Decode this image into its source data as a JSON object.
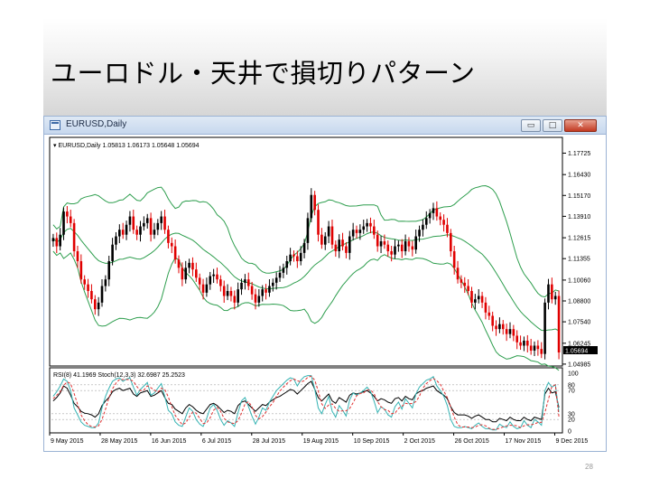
{
  "slide": {
    "title": "ユーロドル・天井で損切りパターン",
    "page_number": "28"
  },
  "window": {
    "title": "EURUSD,Daily",
    "minimize_label": "▭",
    "maximize_label": "□",
    "close_label": "✕"
  },
  "chart_data": [
    {
      "type": "candlestick",
      "title": "EURUSD,Daily  1.05813 1.06173 1.05648 1.05694",
      "symbol": "EURUSD,Daily",
      "last_ohlc": {
        "open": 1.05813,
        "high": 1.06173,
        "low": 1.05648,
        "close": 1.05694
      },
      "current_price_label": "1.05694",
      "y_ticks": [
        1.17725,
        1.1643,
        1.1517,
        1.1391,
        1.12615,
        1.11355,
        1.1006,
        1.088,
        1.0754,
        1.06245,
        1.04985
      ],
      "ylim": [
        1.0498,
        1.1775
      ],
      "x_tick_labels": [
        "9 May 2015",
        "28 May 2015",
        "16 Jun 2015",
        "6 Jul 2015",
        "28 Jul 2015",
        "19 Aug 2015",
        "10 Sep 2015",
        "2 Oct 2015",
        "26 Oct 2015",
        "17 Nov 2015",
        "9 Dec 2015"
      ],
      "indicators": "Bollinger Bands (approx.)",
      "colors": {
        "up": "#000000",
        "down": "#e00000",
        "bands": "#2e9e4e"
      },
      "closes": [
        1.126,
        1.121,
        1.128,
        1.142,
        1.139,
        1.135,
        1.118,
        1.112,
        1.101,
        1.098,
        1.094,
        1.089,
        1.083,
        1.087,
        1.097,
        1.101,
        1.112,
        1.122,
        1.127,
        1.131,
        1.128,
        1.134,
        1.139,
        1.131,
        1.128,
        1.133,
        1.135,
        1.138,
        1.128,
        1.131,
        1.135,
        1.139,
        1.131,
        1.123,
        1.121,
        1.113,
        1.108,
        1.101,
        1.108,
        1.111,
        1.107,
        1.102,
        1.098,
        1.093,
        1.098,
        1.103,
        1.104,
        1.101,
        1.097,
        1.091,
        1.094,
        1.091,
        1.087,
        1.095,
        1.099,
        1.101,
        1.097,
        1.092,
        1.087,
        1.091,
        1.095,
        1.093,
        1.097,
        1.099,
        1.102,
        1.105,
        1.108,
        1.112,
        1.116,
        1.115,
        1.112,
        1.117,
        1.123,
        1.138,
        1.152,
        1.143,
        1.128,
        1.122,
        1.127,
        1.133,
        1.122,
        1.118,
        1.125,
        1.121,
        1.117,
        1.127,
        1.131,
        1.129,
        1.131,
        1.133,
        1.135,
        1.133,
        1.128,
        1.121,
        1.124,
        1.122,
        1.118,
        1.116,
        1.121,
        1.122,
        1.118,
        1.124,
        1.121,
        1.119,
        1.127,
        1.131,
        1.134,
        1.138,
        1.141,
        1.144,
        1.139,
        1.137,
        1.134,
        1.129,
        1.118,
        1.108,
        1.101,
        1.099,
        1.097,
        1.094,
        1.087,
        1.089,
        1.091,
        1.087,
        1.081,
        1.079,
        1.073,
        1.071,
        1.074,
        1.071,
        1.068,
        1.071,
        1.067,
        1.063,
        1.061,
        1.064,
        1.061,
        1.058,
        1.061,
        1.059,
        1.056,
        1.087,
        1.098,
        1.089,
        1.091,
        1.0569
      ]
    },
    {
      "type": "line",
      "title": "RSI(8) 41.1969  Stoch(12,3,3) 32.6987 25.2523",
      "y_ticks": [
        100,
        80,
        70,
        30,
        20,
        0
      ],
      "ylim": [
        0,
        100
      ],
      "series": [
        {
          "name": "RSI(8)",
          "color": "#000000",
          "values": [
            52,
            58,
            66,
            78,
            74,
            62,
            48,
            42,
            34,
            31,
            30,
            28,
            24,
            30,
            44,
            52,
            58,
            68,
            72,
            74,
            70,
            72,
            74,
            64,
            60,
            66,
            68,
            70,
            60,
            62,
            66,
            70,
            58,
            48,
            46,
            38,
            34,
            30,
            40,
            46,
            42,
            36,
            32,
            30,
            38,
            46,
            48,
            44,
            38,
            32,
            36,
            34,
            30,
            44,
            50,
            52,
            46,
            40,
            34,
            40,
            46,
            44,
            50,
            54,
            58,
            60,
            64,
            68,
            72,
            70,
            64,
            70,
            76,
            82,
            86,
            72,
            58,
            52,
            58,
            64,
            52,
            48,
            58,
            54,
            50,
            62,
            66,
            64,
            66,
            68,
            70,
            66,
            60,
            52,
            56,
            54,
            50,
            48,
            56,
            58,
            52,
            60,
            56,
            54,
            64,
            68,
            70,
            74,
            76,
            78,
            70,
            66,
            62,
            56,
            42,
            32,
            28,
            28,
            28,
            26,
            22,
            26,
            28,
            24,
            20,
            20,
            16,
            16,
            22,
            20,
            18,
            24,
            20,
            18,
            18,
            24,
            20,
            18,
            24,
            22,
            20,
            64,
            74,
            66,
            68,
            41
          ]
        },
        {
          "name": "Stoch main",
          "color": "#35b3b3",
          "values": [
            60,
            68,
            78,
            90,
            86,
            70,
            40,
            28,
            16,
            10,
            8,
            6,
            6,
            14,
            40,
            60,
            74,
            86,
            90,
            92,
            86,
            90,
            92,
            76,
            62,
            72,
            78,
            84,
            62,
            66,
            74,
            82,
            60,
            36,
            30,
            16,
            10,
            8,
            24,
            40,
            34,
            20,
            12,
            8,
            22,
            40,
            46,
            36,
            20,
            10,
            18,
            14,
            8,
            32,
            52,
            58,
            42,
            26,
            12,
            24,
            40,
            36,
            50,
            60,
            70,
            76,
            82,
            88,
            92,
            90,
            78,
            88,
            94,
            96,
            96,
            72,
            40,
            30,
            46,
            60,
            34,
            24,
            44,
            36,
            26,
            54,
            66,
            62,
            66,
            70,
            76,
            68,
            52,
            32,
            42,
            38,
            28,
            24,
            42,
            50,
            38,
            56,
            48,
            40,
            64,
            76,
            82,
            88,
            90,
            94,
            78,
            70,
            60,
            44,
            20,
            8,
            6,
            6,
            8,
            6,
            4,
            10,
            14,
            8,
            4,
            4,
            2,
            2,
            12,
            8,
            6,
            16,
            8,
            4,
            6,
            18,
            10,
            6,
            20,
            16,
            10,
            70,
            84,
            76,
            80,
            33
          ]
        },
        {
          "name": "Stoch signal",
          "color": "#e03030",
          "values": [
            56,
            62,
            68,
            79,
            85,
            82,
            65,
            46,
            28,
            18,
            11,
            8,
            7,
            9,
            20,
            38,
            58,
            73,
            83,
            89,
            89,
            89,
            89,
            86,
            77,
            70,
            71,
            78,
            75,
            71,
            67,
            74,
            72,
            59,
            42,
            27,
            19,
            11,
            14,
            24,
            33,
            31,
            22,
            13,
            14,
            23,
            36,
            41,
            34,
            22,
            16,
            14,
            13,
            18,
            31,
            47,
            51,
            42,
            27,
            21,
            25,
            33,
            42,
            49,
            60,
            69,
            76,
            82,
            87,
            90,
            87,
            85,
            87,
            93,
            95,
            88,
            69,
            47,
            39,
            45,
            47,
            39,
            34,
            35,
            35,
            39,
            49,
            61,
            65,
            66,
            71,
            71,
            65,
            51,
            42,
            37,
            36,
            30,
            31,
            39,
            43,
            48,
            47,
            48,
            51,
            60,
            74,
            82,
            87,
            91,
            87,
            81,
            69,
            58,
            41,
            24,
            11,
            7,
            7,
            7,
            6,
            7,
            10,
            11,
            9,
            5,
            3,
            3,
            5,
            7,
            9,
            10,
            10,
            9,
            6,
            9,
            11,
            11,
            12,
            15,
            15,
            32,
            55,
            77,
            80,
            25
          ]
        }
      ]
    }
  ]
}
